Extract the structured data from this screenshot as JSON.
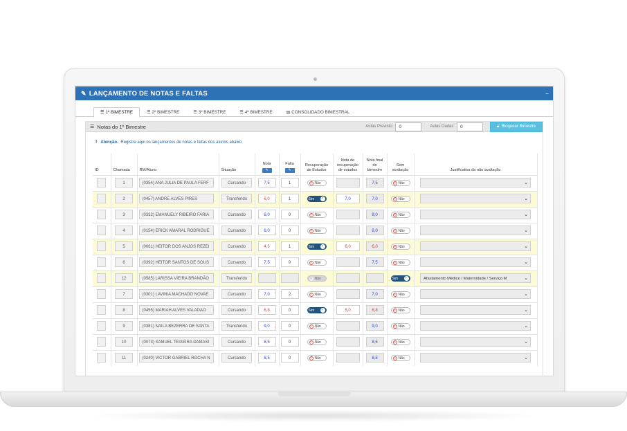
{
  "window": {
    "title": "LANÇAMENTO DE NOTAS E FALTAS"
  },
  "tabs": [
    {
      "label": "1º BIMESTRE",
      "active": true
    },
    {
      "label": "2º BIMESTRE",
      "active": false
    },
    {
      "label": "3º BIMESTRE",
      "active": false
    },
    {
      "label": "4º BIMESTRE",
      "active": false
    },
    {
      "label": "CONSOLIDADO BIMESTRAL",
      "active": false
    }
  ],
  "panel": {
    "title": "Notas do 1º Bimestre",
    "aulas_previstas_label": "Aulas Previsto:",
    "aulas_previstas_value": "0",
    "aulas_dadas_label": "Aulas Dadas:",
    "aulas_dadas_value": "0",
    "lock_button": "Bloquear Bimestre"
  },
  "alert": {
    "strong": "Atenção.",
    "text": "Registre aqui os lançamentos de notas e faltas dos alunos abaixo"
  },
  "columns": {
    "id": "ID",
    "chamada": "Chamada",
    "rm_aluno": "RM/Aluno",
    "situacao": "Situação",
    "nota": "Nota",
    "falta": "Falta",
    "recuperacao": [
      "Recuperação",
      "de Estudos"
    ],
    "nota_recuperacao": [
      "Nota de",
      "recuperação",
      "de estudos"
    ],
    "nota_final": [
      "Nota final",
      "do",
      "bimestre"
    ],
    "sem_avaliacao": [
      "Sem",
      "avaliação"
    ],
    "justificativa": "Justificativa da não avaliação"
  },
  "toggle_labels": {
    "yes": "Sim",
    "no": "Não"
  },
  "colors": {
    "header": "#2d72b6",
    "highlight_row": "#fdfbd6",
    "grade_ok": "#2b3fd4",
    "grade_low": "#e03b2b",
    "lock_button": "#5bc0de"
  },
  "rows": [
    {
      "chamada": "1",
      "aluno": "(0354) ANA JULIA DE PAULA FERF",
      "situacao": "Cursando",
      "nota": "7,5",
      "nota_color": "blue",
      "falta": "1",
      "recuperacao": "Não",
      "nota_recuperacao": "",
      "nota_final": "7,5",
      "final_color": "blue",
      "sem_avaliacao": "Não",
      "justificativa": "",
      "highlight": false
    },
    {
      "chamada": "2",
      "aluno": "(0457) ANDRE ALVES PIRES",
      "situacao": "Transferido",
      "nota": "6,0",
      "nota_color": "red",
      "falta": "1",
      "recuperacao": "Sim",
      "nota_recuperacao": "7,0",
      "nota_final": "7,0",
      "final_color": "blue",
      "sem_avaliacao": "Não",
      "justificativa": "",
      "highlight": true
    },
    {
      "chamada": "3",
      "aluno": "(0332) EMANUELY RIBEIRO FARIA",
      "situacao": "Cursando",
      "nota": "8,0",
      "nota_color": "blue",
      "falta": "0",
      "recuperacao": "Não",
      "nota_recuperacao": "",
      "nota_final": "8,0",
      "final_color": "blue",
      "sem_avaliacao": "Não",
      "justificativa": "",
      "highlight": false
    },
    {
      "chamada": "4",
      "aluno": "(0154) ERICK AMARAL RODRIGUE",
      "situacao": "Cursando",
      "nota": "8,0",
      "nota_color": "blue",
      "falta": "0",
      "recuperacao": "Não",
      "nota_recuperacao": "",
      "nota_final": "8,0",
      "final_color": "blue",
      "sem_avaliacao": "Não",
      "justificativa": "",
      "highlight": false
    },
    {
      "chamada": "5",
      "aluno": "(0061) HEITOR DOS ANJOS REZEI",
      "situacao": "Cursando",
      "nota": "4,5",
      "nota_color": "red",
      "falta": "1",
      "recuperacao": "Sim",
      "nota_recuperacao": "6,0",
      "nota_final": "6,0",
      "final_color": "red",
      "sem_avaliacao": "Não",
      "justificativa": "",
      "highlight": true
    },
    {
      "chamada": "6",
      "aluno": "(0392) HEITOR SANTOS DE SOUS",
      "situacao": "Cursando",
      "nota": "7,5",
      "nota_color": "blue",
      "falta": "0",
      "recuperacao": "Não",
      "nota_recuperacao": "",
      "nota_final": "7,5",
      "final_color": "blue",
      "sem_avaliacao": "Não",
      "justificativa": "",
      "highlight": false
    },
    {
      "chamada": "12",
      "aluno": "(0585) LARISSA VIEIRA BRANDÃO",
      "situacao": "Transferido",
      "nota": "",
      "nota_color": "dark",
      "falta": "",
      "recuperacao": "Não",
      "nota_recuperacao": "",
      "nota_final": "",
      "final_color": "blue",
      "sem_avaliacao": "Sim",
      "justificativa": "Afastamento Médico / Maternidade / Serviço M",
      "highlight": true
    },
    {
      "chamada": "7",
      "aluno": "(0301) LAVINIA MACHADO NOVAE",
      "situacao": "Cursando",
      "nota": "7,0",
      "nota_color": "blue",
      "falta": "2",
      "recuperacao": "Não",
      "nota_recuperacao": "",
      "nota_final": "7,0",
      "final_color": "blue",
      "sem_avaliacao": "Não",
      "justificativa": "",
      "highlight": false
    },
    {
      "chamada": "8",
      "aluno": "(0455) MARIAH ALVES VALADAO",
      "situacao": "Cursando",
      "nota": "6,8",
      "nota_color": "red",
      "falta": "0",
      "recuperacao": "Sim",
      "nota_recuperacao": "5,0",
      "nota_final": "6,8",
      "final_color": "red",
      "sem_avaliacao": "Não",
      "justificativa": "",
      "highlight": false
    },
    {
      "chamada": "9",
      "aluno": "(0381) NAILA BEZERRA DE SANTA",
      "situacao": "Transferido",
      "nota": "9,0",
      "nota_color": "blue",
      "falta": "0",
      "recuperacao": "Não",
      "nota_recuperacao": "",
      "nota_final": "9,0",
      "final_color": "blue",
      "sem_avaliacao": "Não",
      "justificativa": "",
      "highlight": false
    },
    {
      "chamada": "10",
      "aluno": "(0073) SAMUEL TEIXEIRA DAMASI",
      "situacao": "Cursando",
      "nota": "8,5",
      "nota_color": "blue",
      "falta": "0",
      "recuperacao": "Não",
      "nota_recuperacao": "",
      "nota_final": "8,5",
      "final_color": "blue",
      "sem_avaliacao": "Não",
      "justificativa": "",
      "highlight": false
    },
    {
      "chamada": "11",
      "aluno": "(0240) VICTOR GABRIEL ROCHA N",
      "situacao": "Cursando",
      "nota": "8,5",
      "nota_color": "blue",
      "falta": "0",
      "recuperacao": "Não",
      "nota_recuperacao": "",
      "nota_final": "8,5",
      "final_color": "blue",
      "sem_avaliacao": "Não",
      "justificativa": "",
      "highlight": false
    }
  ]
}
